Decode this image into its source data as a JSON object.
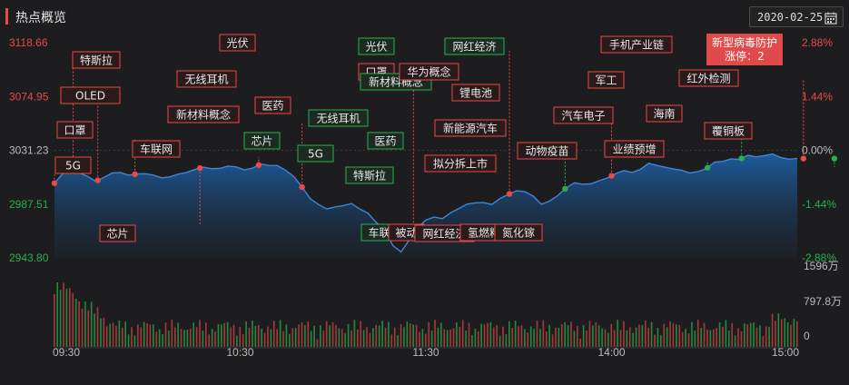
{
  "header": {
    "title": "热点概览",
    "date": "2020-02-25",
    "calendar_icon": "calendar-icon"
  },
  "colors": {
    "up": "#e84a4a",
    "down": "#26b14c",
    "text": "#bbbbbb",
    "line": "#3f86d6"
  },
  "chart_data": {
    "type": "line",
    "x_ticks": [
      "09:30",
      "10:30",
      "11:30",
      "14:00",
      "15:00"
    ],
    "y_left_ticks": [
      "3118.66",
      "3074.95",
      "3031.23",
      "2987.51",
      "2943.80"
    ],
    "y_right_ticks": [
      "2.88%",
      "1.44%",
      "0.00%",
      "-1.44%",
      "-2.88%"
    ],
    "ylim": [
      2943.8,
      3118.66
    ],
    "prev_close": 3031.23,
    "volume_ticks": [
      "1596万",
      "797.8万",
      "0"
    ],
    "series_index": [
      3004.5,
      3012.3,
      3014.8,
      3012.8,
      3010.1,
      3006.0,
      3009.2,
      3012.8,
      3013.2,
      3011.0,
      3012.0,
      3012.2,
      3011.0,
      3008.9,
      3009.6,
      3011.8,
      3013.2,
      3015.6,
      3017.5,
      3016.3,
      3016.5,
      3018.4,
      3017.7,
      3015.4,
      3016.7,
      3020.1,
      3018.9,
      3018.8,
      3015.1,
      3009.8,
      3001.3,
      2991.8,
      2987.2,
      2983.6,
      2985.2,
      2986.3,
      2987.9,
      2983.5,
      2980.0,
      2972.4,
      2966.9,
      2953.8,
      2948.6,
      2958.5,
      2968.4,
      2974.5,
      2976.9,
      2975.7,
      2980.4,
      2983.9,
      2987.5,
      2988.5,
      2988.7,
      2987.2,
      2992.1,
      2995.4,
      2998.3,
      2997.6,
      2994.0,
      2987.3,
      2990.0,
      2994.5,
      3000.7,
      3004.8,
      3003.6,
      3003.9,
      3006.5,
      3008.7,
      3012.2,
      3014.7,
      3013.2,
      3015.7,
      3020.6,
      3018.9,
      3017.4,
      3016.0,
      3014.9,
      3012.7,
      3014.0,
      3016.4,
      3021.6,
      3022.2,
      3024.3,
      3023.8,
      3027.2,
      3025.9,
      3026.8,
      3028.2,
      3025.4,
      3024.0,
      3024.5
    ],
    "points": [
      {
        "t": 0,
        "c": "up"
      },
      {
        "t": 6,
        "c": "up"
      },
      {
        "t": 14,
        "c": "up"
      },
      {
        "t": 26,
        "c": "up"
      },
      {
        "t": 47,
        "c": "up"
      },
      {
        "t": 66,
        "c": "up"
      },
      {
        "t": 80,
        "c": "up"
      },
      {
        "t": 116,
        "c": "up"
      },
      {
        "t": 147,
        "c": "up"
      },
      {
        "t": 165,
        "c": "down"
      },
      {
        "t": 180,
        "c": "up"
      },
      {
        "t": 211,
        "c": "down"
      },
      {
        "t": 222,
        "c": "down"
      },
      {
        "t": 242,
        "c": "up"
      },
      {
        "t": 252,
        "c": "down"
      },
      {
        "t": 259,
        "c": "down"
      },
      {
        "t": 265,
        "c": "down"
      },
      {
        "t": 316,
        "c": "up"
      },
      {
        "t": 326,
        "c": "up"
      },
      {
        "t": 330,
        "c": "up"
      },
      {
        "t": 346,
        "c": "up"
      },
      {
        "t": 352,
        "c": "up"
      },
      {
        "t": 356,
        "c": "up"
      },
      {
        "t": 357,
        "c": "up"
      },
      {
        "t": 361,
        "c": "up"
      },
      {
        "t": 362,
        "c": "up"
      },
      {
        "t": 389,
        "c": "up"
      },
      {
        "t": 398,
        "c": "up"
      },
      {
        "t": 452,
        "c": "up"
      },
      {
        "t": 478,
        "c": "up"
      },
      {
        "t": 500,
        "c": "up"
      },
      {
        "t": 535,
        "c": "up"
      },
      {
        "t": 546,
        "c": "up"
      },
      {
        "t": 580,
        "c": "up"
      },
      {
        "t": 618,
        "c": "up"
      },
      {
        "t": 640,
        "c": "up"
      },
      {
        "t": 655,
        "c": "up"
      },
      {
        "t": 680,
        "c": "up"
      },
      {
        "t": 705,
        "c": "up"
      }
    ],
    "annotations": [
      {
        "text": "特斯拉",
        "c": "up",
        "lx": 80,
        "ly": 57,
        "px": 6
      },
      {
        "text": "OLED",
        "c": "up",
        "lx": 67,
        "ly": 96,
        "px": 14
      },
      {
        "text": "口罩",
        "c": "up",
        "lx": 63,
        "ly": 134,
        "px": 26
      },
      {
        "text": "5G",
        "c": "up",
        "lx": 61,
        "ly": 173,
        "px": 0
      },
      {
        "text": "芯片",
        "c": "up",
        "lx": 110,
        "ly": 248,
        "px": 47
      },
      {
        "text": "车联网",
        "c": "up",
        "lx": 146,
        "ly": 155,
        "px": 66
      },
      {
        "text": "新材料概念",
        "c": "up",
        "lx": 185,
        "ly": 117,
        "px": 80
      },
      {
        "text": "无线耳机",
        "c": "up",
        "lx": 195,
        "ly": 78,
        "px": 116
      },
      {
        "text": "光伏",
        "c": "up",
        "lx": 242,
        "ly": 38,
        "px": 147
      },
      {
        "text": "医药",
        "c": "up",
        "lx": 281,
        "ly": 107,
        "px": 180
      },
      {
        "text": "芯片",
        "c": "down",
        "lx": 269,
        "ly": 146,
        "px": 165
      },
      {
        "text": "5G",
        "c": "down",
        "lx": 328,
        "ly": 160,
        "px": 211
      },
      {
        "text": "无线耳机",
        "c": "down",
        "lx": 340,
        "ly": 121,
        "px": 222
      },
      {
        "text": "特斯拉",
        "c": "down",
        "lx": 381,
        "ly": 184,
        "px": 252
      },
      {
        "text": "光伏",
        "c": "down",
        "lx": 395,
        "ly": 42,
        "px": 259
      },
      {
        "text": "口罩",
        "c": "up",
        "lx": 395,
        "ly": 70,
        "px": 242
      },
      {
        "text": "新材料概念",
        "c": "down",
        "lx": 397,
        "ly": 81,
        "px": 262
      },
      {
        "text": "医药",
        "c": "down",
        "lx": 405,
        "ly": 146,
        "px": 265
      },
      {
        "text": "车联",
        "c": "down",
        "lx": 398,
        "ly": 247,
        "px": 259
      },
      {
        "text": "被动",
        "c": "up",
        "lx": 428,
        "ly": 247,
        "px": 300
      },
      {
        "text": "华为概念",
        "c": "up",
        "lx": 440,
        "ly": 70,
        "px": 316
      },
      {
        "text": "网红经济",
        "c": "down",
        "lx": 490,
        "ly": 42,
        "px": 326
      },
      {
        "text": "网红经济",
        "c": "up",
        "lx": 457,
        "ly": 248,
        "px": 330
      },
      {
        "text": "拟分拆上市",
        "c": "up",
        "lx": 468,
        "ly": 171,
        "px": 330
      },
      {
        "text": "锂电池",
        "c": "up",
        "lx": 498,
        "ly": 93,
        "px": 346
      },
      {
        "text": "新能源汽车",
        "c": "up",
        "lx": 479,
        "ly": 132,
        "px": 352
      },
      {
        "text": "氢燃料",
        "c": "up",
        "lx": 507,
        "ly": 247,
        "px": 357
      },
      {
        "text": "氮化镓",
        "c": "up",
        "lx": 545,
        "ly": 247,
        "px": 389
      },
      {
        "text": "动物疫苗",
        "c": "up",
        "lx": 570,
        "ly": 157,
        "px": 452
      },
      {
        "text": "汽车电子",
        "c": "up",
        "lx": 610,
        "ly": 118,
        "px": 478
      },
      {
        "text": "军工",
        "c": "up",
        "lx": 648,
        "ly": 79,
        "px": 500
      },
      {
        "text": "手机产业链",
        "c": "up",
        "lx": 662,
        "ly": 40,
        "px": 535
      },
      {
        "text": "业绩预增",
        "c": "up",
        "lx": 666,
        "ly": 155,
        "px": 546
      },
      {
        "text": "海南",
        "c": "up",
        "lx": 712,
        "ly": 116,
        "px": 580
      },
      {
        "text": "红外检测",
        "c": "up",
        "lx": 748,
        "ly": 77,
        "px": 618
      },
      {
        "text": "覆铜板",
        "c": "up",
        "lx": 776,
        "ly": 135,
        "px": 655
      }
    ],
    "highlight": {
      "line1": "新型病毒防护",
      "line2": "涨停：2",
      "t": 705
    }
  }
}
